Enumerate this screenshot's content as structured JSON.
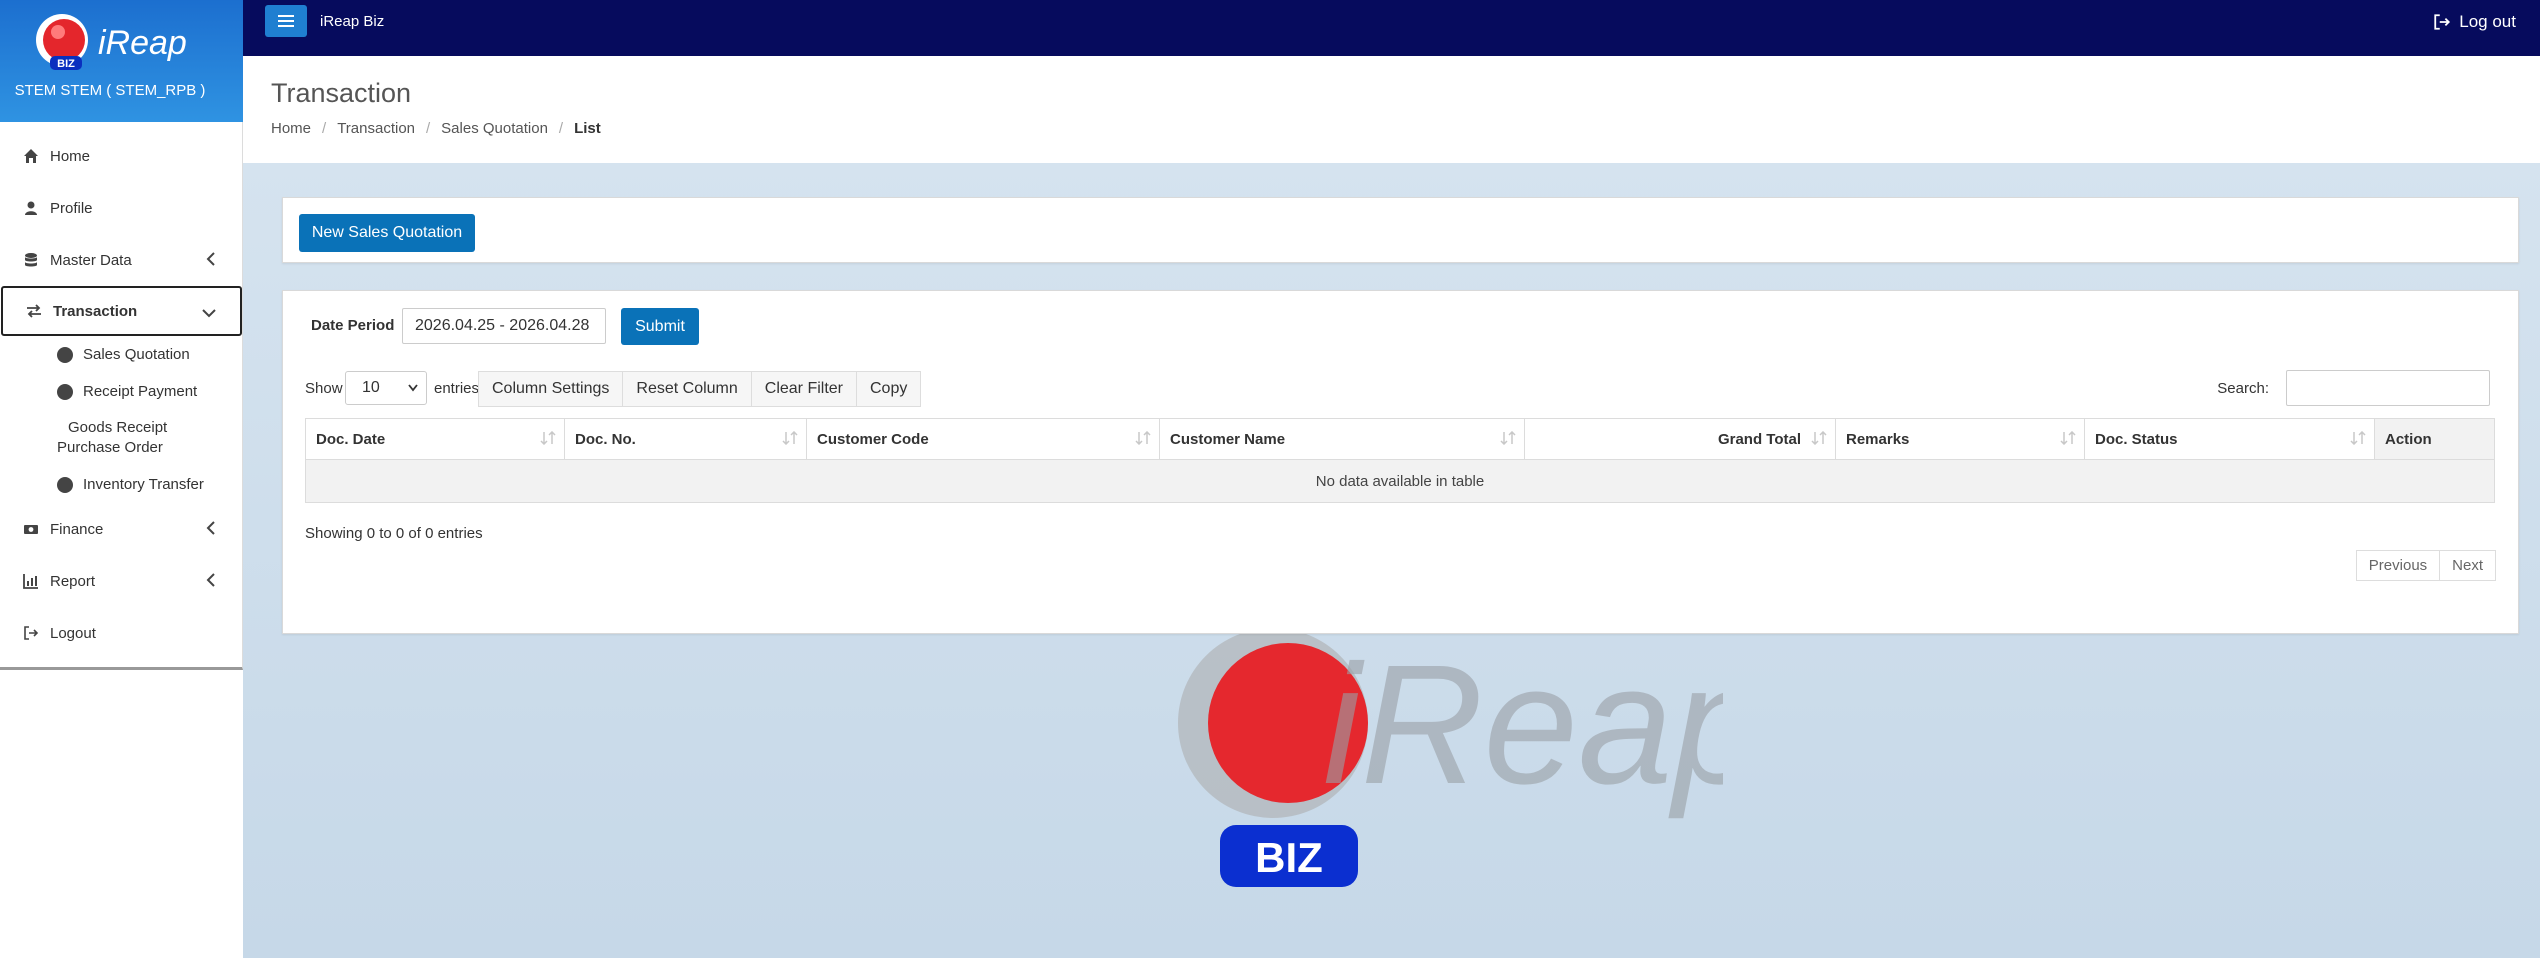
{
  "brand": {
    "logo_text": "iReap",
    "logo_badge": "BIZ",
    "company": "STEM STEM ( STEM_RPB )"
  },
  "topbar": {
    "app_title": "iReap Biz",
    "logout_label": "Log out"
  },
  "sidebar": {
    "items": [
      {
        "label": "Home",
        "icon": "home-icon"
      },
      {
        "label": "Profile",
        "icon": "user-icon"
      },
      {
        "label": "Master Data",
        "icon": "database-icon"
      },
      {
        "label": "Transaction",
        "icon": "exchange-icon"
      },
      {
        "label": "Finance",
        "icon": "money-icon"
      },
      {
        "label": "Report",
        "icon": "chart-icon"
      },
      {
        "label": "Logout",
        "icon": "logout-icon"
      }
    ],
    "transaction_sub": [
      "Sales Quotation",
      "Receipt Payment",
      "Goods Receipt Purchase Order",
      "Inventory Transfer"
    ]
  },
  "page": {
    "title": "Transaction",
    "breadcrumb": [
      "Home",
      "Transaction",
      "Sales Quotation",
      "List"
    ]
  },
  "toolbar": {
    "new_button": "New Sales Quotation"
  },
  "filter": {
    "date_label": "Date Period",
    "date_value": "2026.04.25 - 2026.04.28",
    "submit_label": "Submit"
  },
  "table_controls": {
    "show_label": "Show",
    "entries_value": "10",
    "entries_label": "entries",
    "buttons": [
      "Column Settings",
      "Reset Column",
      "Clear Filter",
      "Copy"
    ],
    "search_label": "Search:"
  },
  "table": {
    "columns": [
      "Doc. Date",
      "Doc. No.",
      "Customer Code",
      "Customer Name",
      "Grand Total",
      "Remarks",
      "Doc. Status",
      "Action"
    ],
    "empty_message": "No data available in table",
    "info": "Showing 0 to 0 of 0 entries",
    "pager": [
      "Previous",
      "Next"
    ]
  },
  "colors": {
    "topbar": "#060b5d",
    "primary": "#0a72b8",
    "brand_gradient_start": "#1c6fcf",
    "content_bg": "#d5e3ef"
  }
}
